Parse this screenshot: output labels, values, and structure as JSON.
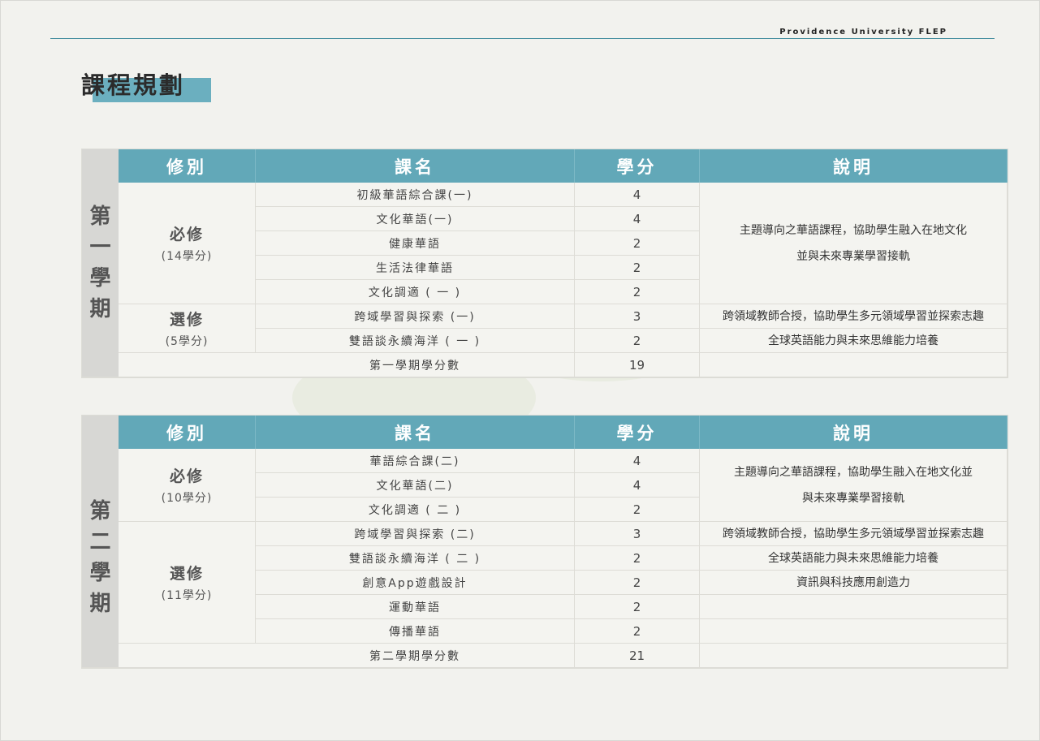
{
  "header": {
    "brand": "Providence University FLEP"
  },
  "page_title": "課程規劃",
  "table_headers": {
    "type": "修別",
    "course": "課名",
    "credit": "學分",
    "desc": "說明"
  },
  "semester1": {
    "label": [
      "第",
      "一",
      "學",
      "期"
    ],
    "required_label": "必修",
    "required_sub": "(14學分)",
    "elective_label": "選修",
    "elective_sub": "(5學分)",
    "courses": [
      {
        "name": "初級華語綜合課(一)",
        "credit": "4"
      },
      {
        "name": "文化華語(一)",
        "credit": "4"
      },
      {
        "name": "健康華語",
        "credit": "2"
      },
      {
        "name": "生活法律華語",
        "credit": "2"
      },
      {
        "name": "文化調適 ( 一 )",
        "credit": "2"
      },
      {
        "name": "跨域學習與探索 (一)",
        "credit": "3"
      },
      {
        "name": "雙語談永續海洋 ( 一 )",
        "credit": "2"
      }
    ],
    "desc_required": [
      "主題導向之華語課程，協助學生融入在地文化",
      "並與未來專業學習接軌"
    ],
    "desc_elective1": "跨領域教師合授，協助學生多元領域學習並探索志趣",
    "desc_elective2": "全球英語能力與未來思維能力培養",
    "total_label": "第一學期學分數",
    "total_credit": "19"
  },
  "semester2": {
    "label": [
      "第",
      "二",
      "學",
      "期"
    ],
    "required_label": "必修",
    "required_sub": "(10學分)",
    "elective_label": "選修",
    "elective_sub": "(11學分)",
    "courses": [
      {
        "name": "華語綜合課(二)",
        "credit": "4"
      },
      {
        "name": "文化華語(二)",
        "credit": "4"
      },
      {
        "name": "文化調適 ( 二 )",
        "credit": "2"
      },
      {
        "name": "跨域學習與探索 (二)",
        "credit": "3"
      },
      {
        "name": "雙語談永續海洋 ( 二 )",
        "credit": "2"
      },
      {
        "name": "創意App遊戲設計",
        "credit": "2"
      },
      {
        "name": "運動華語",
        "credit": "2"
      },
      {
        "name": "傳播華語",
        "credit": "2"
      }
    ],
    "desc_required": [
      "主題導向之華語課程，協助學生融入在地文化並",
      "與未來專業學習接軌"
    ],
    "desc_elective1": "跨領域教師合授，協助學生多元領域學習並探索志趣",
    "desc_elective2": "全球英語能力與未來思維能力培養",
    "desc_elective3": "資訊與科技應用創造力",
    "total_label": "第二學期學分數",
    "total_credit": "21"
  }
}
